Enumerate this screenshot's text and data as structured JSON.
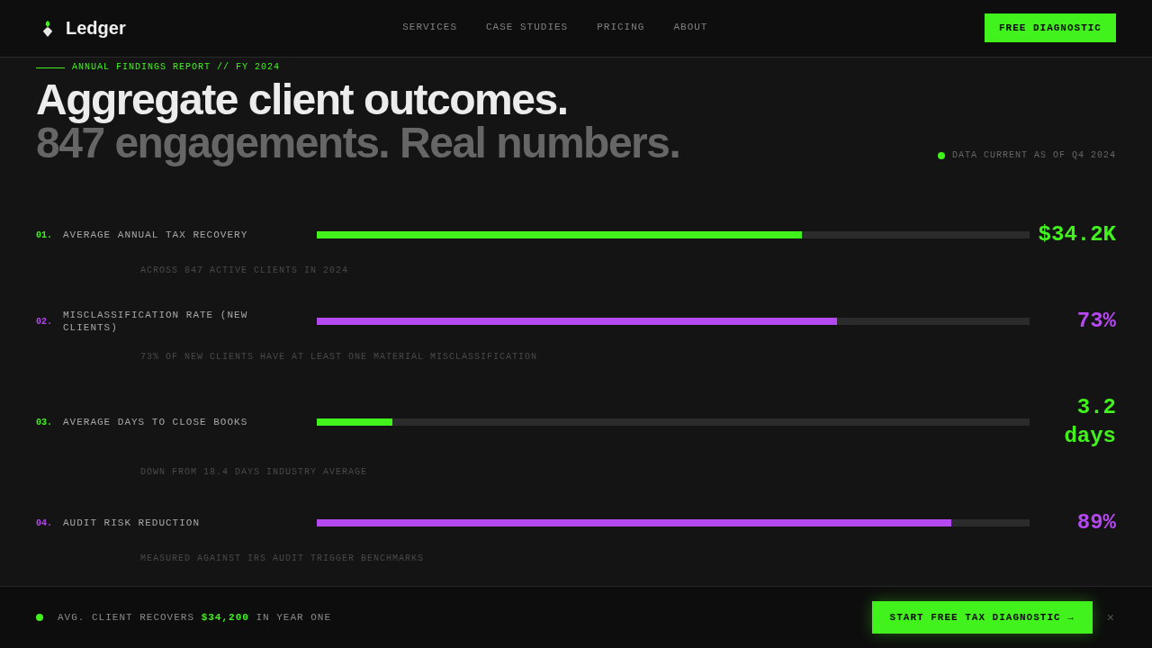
{
  "header": {
    "logo": "Ledger",
    "nav": [
      "SERVICES",
      "CASE STUDIES",
      "PRICING",
      "ABOUT"
    ],
    "cta": "FREE DIAGNOSTIC"
  },
  "hero": {
    "eyebrow": "ANNUAL FINDINGS REPORT // FY 2024",
    "headline": "Aggregate client outcomes.",
    "subheadline": "847 engagements. Real numbers.",
    "data_note": "DATA CURRENT AS OF Q4 2024"
  },
  "metrics": [
    {
      "number": "01.",
      "label": "AVERAGE ANNUAL TAX RECOVERY",
      "level": 0.68,
      "value": "$34.2K",
      "note": "ACROSS 847 ACTIVE CLIENTS IN 2024",
      "color": "#41f21d"
    },
    {
      "number": "02.",
      "label": "MISCLASSIFICATION RATE (NEW CLIENTS)",
      "level": 0.73,
      "value": "73%",
      "note": "73% OF NEW CLIENTS HAVE AT LEAST ONE MATERIAL MISCLASSIFICATION",
      "color": "#b648f2"
    },
    {
      "number": "03.",
      "label": "AVERAGE DAYS TO CLOSE BOOKS",
      "level": 0.106,
      "value": "3.2 days",
      "note": "DOWN FROM 18.4 DAYS INDUSTRY AVERAGE",
      "color": "#41f21d"
    },
    {
      "number": "04.",
      "label": "AUDIT RISK REDUCTION",
      "level": 0.89,
      "value": "89%",
      "note": "MEASURED AGAINST IRS AUDIT TRIGGER BENCHMARKS",
      "color": "#b648f2"
    }
  ],
  "bottom_bar": {
    "message": "AVG. CLIENT RECOVERS **$34,200** IN YEAR ONE",
    "cta": "START FREE TAX DIAGNOSTIC →",
    "close": "×"
  }
}
